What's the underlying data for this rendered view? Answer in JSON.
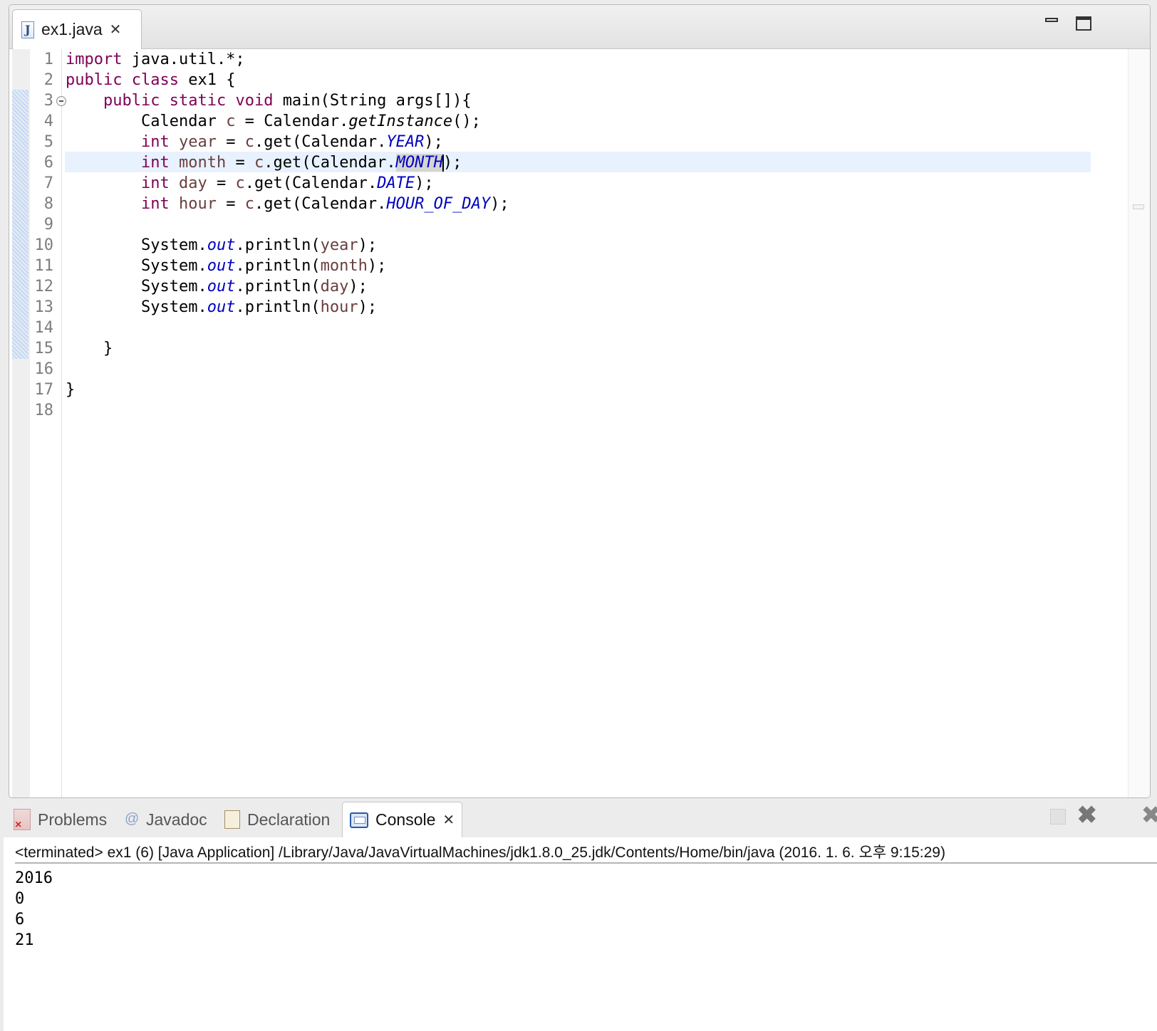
{
  "editor": {
    "tab_title": "ex1.java",
    "line_numbers": [
      "1",
      "2",
      "3",
      "4",
      "5",
      "6",
      "7",
      "8",
      "9",
      "10",
      "11",
      "12",
      "13",
      "14",
      "15",
      "16",
      "17",
      "18"
    ],
    "tokens": {
      "import": "import",
      "public": "public",
      "class": "class",
      "static": "static",
      "void": "void",
      "int": "int",
      "System": "System",
      "out": "out",
      "println": "println",
      "Calendar": "Calendar",
      "getInstance": "getInstance",
      "get": "get",
      "c": "c",
      "year": "year",
      "month": "month",
      "day": "day",
      "hour": "hour",
      "YEAR": "YEAR",
      "MONTH": "MONTH",
      "DATE": "DATE",
      "HOUR_OF_DAY": "HOUR_OF_DAY",
      "package": "java.util.*;",
      "class_decl": "ex1 {",
      "main_decl": "main(String args[]){",
      "close_brace": "}"
    }
  },
  "bottom_panel": {
    "tabs": [
      {
        "label": "Problems"
      },
      {
        "label": "Javadoc"
      },
      {
        "label": "Declaration"
      },
      {
        "label": "Console"
      }
    ],
    "console_header": "<terminated> ex1 (6) [Java Application] /Library/Java/JavaVirtualMachines/jdk1.8.0_25.jdk/Contents/Home/bin/java (2016. 1. 6. 오후 9:15:29)",
    "console_output": [
      "2016",
      "0",
      "6",
      "21"
    ]
  }
}
